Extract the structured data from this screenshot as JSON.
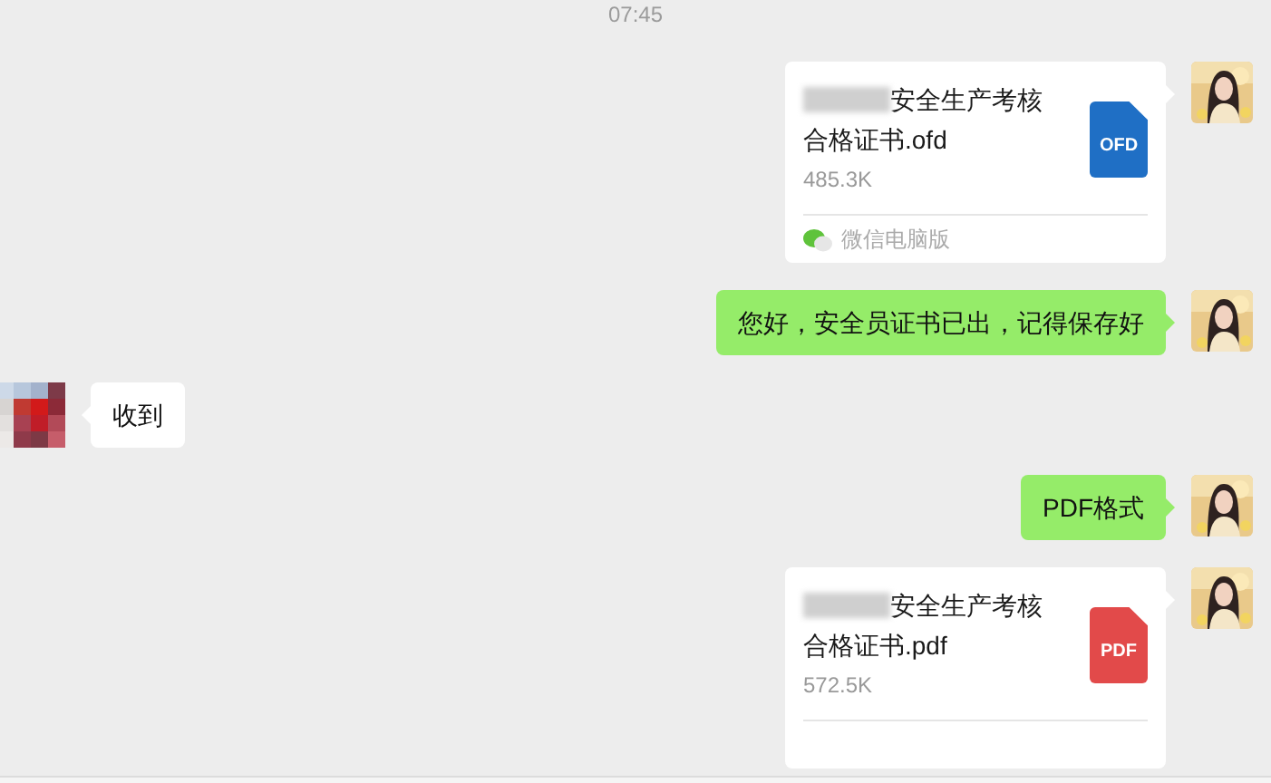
{
  "timestamp": "07:45",
  "messages": [
    {
      "kind": "file",
      "outgoing": true,
      "name_redacted": true,
      "title_lines": [
        "安全生产考核",
        "合格证书.ofd"
      ],
      "size": "485.3K",
      "icon_label": "OFD",
      "color": "#1f6fc5",
      "source": "微信电脑版"
    },
    {
      "kind": "text",
      "outgoing": true,
      "text": "您好，安全员证书已出，记得保存好"
    },
    {
      "kind": "text",
      "outgoing": false,
      "text": "收到"
    },
    {
      "kind": "text",
      "outgoing": true,
      "text": "PDF格式"
    },
    {
      "kind": "file",
      "outgoing": true,
      "name_redacted": true,
      "title_lines": [
        "安全生产考核",
        "合格证书.pdf"
      ],
      "size": "572.5K",
      "icon_label": "PDF",
      "color": "#e24a4a"
    }
  ]
}
